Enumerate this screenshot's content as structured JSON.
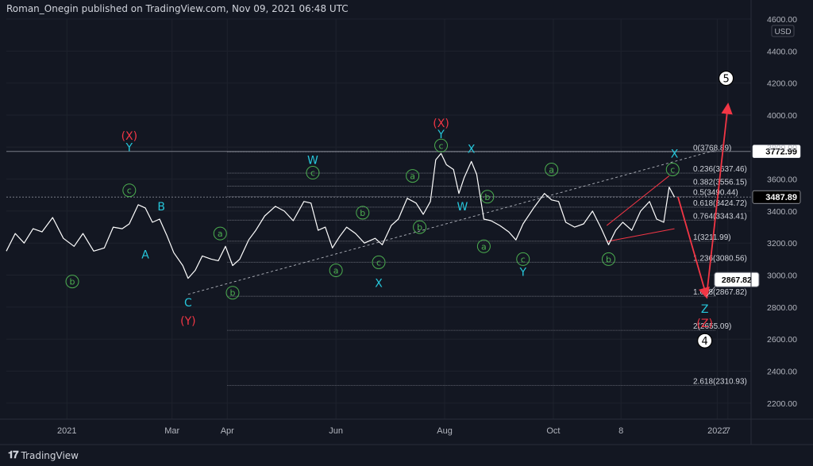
{
  "header": {
    "publisher": "Roman_Onegin published on TradingView.com, Nov 09, 2021 06:48 UTC"
  },
  "footer": {
    "brand": "TradingView",
    "logo_icon": "tradingview-logo-icon"
  },
  "colors": {
    "background": "#131722",
    "grid": "#1e222d",
    "axis_text": "#b2b5be",
    "price": "#ffffff",
    "wave_green": "#4caf50",
    "wave_cyan": "#26c6da",
    "wave_red": "#f23645",
    "fib": "#787b86",
    "arrow": "#f23645"
  },
  "chart_data": {
    "type": "line",
    "symbol_currency": "USD",
    "ylim": [
      2100,
      4600
    ],
    "y_ticks": [
      2200,
      2400,
      2600,
      2800,
      3000,
      3200,
      3400,
      3600,
      3800,
      4000,
      4200,
      4400,
      4600
    ],
    "y_tick_labels": [
      "2200.00",
      "2400.00",
      "2600.00",
      "2800.00",
      "3000.00",
      "3200.00",
      "3400.00",
      "3600.00",
      "3800.00",
      "4000.00",
      "4200.00",
      "4400.00",
      "4600.00"
    ],
    "x_ticks": [
      {
        "label": "2021",
        "date": "2021-01-01"
      },
      {
        "label": "Mar",
        "date": "2021-03-01"
      },
      {
        "label": "Apr",
        "date": "2021-04-01"
      },
      {
        "label": "Jun",
        "date": "2021-06-01"
      },
      {
        "label": "Aug",
        "date": "2021-08-01"
      },
      {
        "label": "Oct",
        "date": "2021-10-01"
      },
      {
        "label": "8",
        "date": "2021-11-08"
      },
      {
        "label": "2022",
        "date": "2022-01-01"
      },
      {
        "label": "7",
        "date": "2022-01-07"
      }
    ],
    "series": [
      {
        "points": [
          [
            "2020-11-28",
            3150
          ],
          [
            "2020-12-03",
            3260
          ],
          [
            "2020-12-08",
            3200
          ],
          [
            "2020-12-13",
            3290
          ],
          [
            "2020-12-18",
            3270
          ],
          [
            "2020-12-24",
            3360
          ],
          [
            "2020-12-30",
            3230
          ],
          [
            "2021-01-05",
            3180
          ],
          [
            "2021-01-10",
            3260
          ],
          [
            "2021-01-16",
            3150
          ],
          [
            "2021-01-22",
            3170
          ],
          [
            "2021-01-27",
            3300
          ],
          [
            "2021-02-01",
            3290
          ],
          [
            "2021-02-05",
            3320
          ],
          [
            "2021-02-10",
            3440
          ],
          [
            "2021-02-14",
            3420
          ],
          [
            "2021-02-18",
            3330
          ],
          [
            "2021-02-22",
            3350
          ],
          [
            "2021-02-26",
            3250
          ],
          [
            "2021-03-02",
            3140
          ],
          [
            "2021-03-07",
            3060
          ],
          [
            "2021-03-10",
            2980
          ],
          [
            "2021-03-14",
            3030
          ],
          [
            "2021-03-18",
            3120
          ],
          [
            "2021-03-23",
            3100
          ],
          [
            "2021-03-27",
            3090
          ],
          [
            "2021-03-31",
            3180
          ],
          [
            "2021-04-04",
            3060
          ],
          [
            "2021-04-08",
            3100
          ],
          [
            "2021-04-13",
            3220
          ],
          [
            "2021-04-17",
            3280
          ],
          [
            "2021-04-22",
            3370
          ],
          [
            "2021-04-28",
            3430
          ],
          [
            "2021-05-03",
            3400
          ],
          [
            "2021-05-08",
            3340
          ],
          [
            "2021-05-14",
            3460
          ],
          [
            "2021-05-18",
            3450
          ],
          [
            "2021-05-22",
            3280
          ],
          [
            "2021-05-26",
            3300
          ],
          [
            "2021-05-30",
            3170
          ],
          [
            "2021-06-03",
            3240
          ],
          [
            "2021-06-07",
            3300
          ],
          [
            "2021-06-12",
            3260
          ],
          [
            "2021-06-17",
            3200
          ],
          [
            "2021-06-23",
            3230
          ],
          [
            "2021-06-27",
            3190
          ],
          [
            "2021-07-02",
            3310
          ],
          [
            "2021-07-06",
            3350
          ],
          [
            "2021-07-11",
            3480
          ],
          [
            "2021-07-16",
            3450
          ],
          [
            "2021-07-20",
            3380
          ],
          [
            "2021-07-24",
            3460
          ],
          [
            "2021-07-27",
            3720
          ],
          [
            "2021-07-30",
            3760
          ],
          [
            "2021-08-02",
            3690
          ],
          [
            "2021-08-06",
            3660
          ],
          [
            "2021-08-09",
            3510
          ],
          [
            "2021-08-12",
            3610
          ],
          [
            "2021-08-16",
            3710
          ],
          [
            "2021-08-19",
            3630
          ],
          [
            "2021-08-23",
            3350
          ],
          [
            "2021-08-27",
            3340
          ],
          [
            "2021-09-01",
            3310
          ],
          [
            "2021-09-06",
            3270
          ],
          [
            "2021-09-10",
            3220
          ],
          [
            "2021-09-14",
            3320
          ],
          [
            "2021-09-20",
            3420
          ],
          [
            "2021-09-26",
            3510
          ],
          [
            "2021-09-30",
            3470
          ],
          [
            "2021-10-04",
            3460
          ],
          [
            "2021-10-08",
            3330
          ],
          [
            "2021-10-13",
            3300
          ],
          [
            "2021-10-18",
            3320
          ],
          [
            "2021-10-23",
            3400
          ],
          [
            "2021-10-28",
            3290
          ],
          [
            "2021-11-01",
            3190
          ],
          [
            "2021-11-05",
            3280
          ],
          [
            "2021-11-09",
            3330
          ],
          [
            "2021-11-14",
            3280
          ],
          [
            "2021-11-19",
            3400
          ],
          [
            "2021-11-24",
            3460
          ],
          [
            "2021-11-28",
            3350
          ],
          [
            "2021-12-02",
            3330
          ],
          [
            "2021-12-05",
            3550
          ],
          [
            "2021-12-08",
            3487.89
          ]
        ]
      }
    ],
    "price_labels": [
      {
        "label": "3772.99",
        "value": 3772.99,
        "style": "white"
      },
      {
        "label": "3487.89",
        "value": 3487.89,
        "style": "dark"
      }
    ],
    "horizontal_lines": [
      {
        "value": 3772.99,
        "color": "#787b86"
      },
      {
        "value": 3487.89,
        "color": "#787b86",
        "dashed": true
      }
    ],
    "fib_levels": [
      {
        "ratio": "0",
        "price": "3768.89",
        "value": 3768.89,
        "label": "0(3768.89)"
      },
      {
        "ratio": "0.236",
        "price": "3637.46",
        "value": 3637.46,
        "label": "0.236(3637.46)"
      },
      {
        "ratio": "0.382",
        "price": "3556.15",
        "value": 3556.15,
        "label": "0.382(3556.15)"
      },
      {
        "ratio": "0.5",
        "price": "3490.44",
        "value": 3490.44,
        "label": "0.5(3490.44)"
      },
      {
        "ratio": "0.618",
        "price": "3424.72",
        "value": 3424.72,
        "label": "0.618(3424.72)"
      },
      {
        "ratio": "0.764",
        "price": "3343.41",
        "value": 3343.41,
        "label": "0.764(3343.41)"
      },
      {
        "ratio": "1",
        "price": "3211.99",
        "value": 3211.99,
        "label": "1(3211.99)"
      },
      {
        "ratio": "1.236",
        "price": "3080.56",
        "value": 3080.56,
        "label": "1.236(3080.56)"
      },
      {
        "ratio": "1.618",
        "price": "2867.82",
        "value": 2867.82,
        "label": "1.618(2867.82)"
      },
      {
        "ratio": "2",
        "price": "2655.09",
        "value": 2655.09,
        "label": "2(2655.09)"
      },
      {
        "ratio": "2.618",
        "price": "2310.93",
        "value": 2310.93,
        "label": "2.618(2310.93)"
      }
    ],
    "fib_range": {
      "from": "2021-04-01",
      "to": "2021-12-31"
    },
    "trendline": {
      "from": [
        "2021-03-10",
        2880
      ],
      "to": [
        "2021-12-31",
        3780
      ]
    },
    "triangle": {
      "upper": [
        [
          "2021-10-31",
          3310
        ],
        [
          "2021-12-05",
          3620
        ]
      ],
      "lower": [
        [
          "2021-10-31",
          3210
        ],
        [
          "2021-12-08",
          3290
        ]
      ]
    },
    "projection": {
      "points": [
        [
          "2021-12-10",
          3487.89
        ],
        [
          "2021-12-26",
          2867.82
        ],
        [
          "2022-01-07",
          4060
        ]
      ],
      "target_label": "2867.82",
      "target_value": 2867.82
    },
    "annotations": [
      {
        "text": "b",
        "kind": "green-circle",
        "date": "2021-01-04",
        "value": 2960
      },
      {
        "text": "(X)",
        "kind": "red",
        "date": "2021-02-05",
        "value": 3870
      },
      {
        "text": "Y",
        "kind": "cyan",
        "date": "2021-02-05",
        "value": 3800
      },
      {
        "text": "c",
        "kind": "green-circle",
        "date": "2021-02-05",
        "value": 3530
      },
      {
        "text": "B",
        "kind": "cyan",
        "date": "2021-02-23",
        "value": 3430
      },
      {
        "text": "A",
        "kind": "cyan",
        "date": "2021-02-14",
        "value": 3130
      },
      {
        "text": "C",
        "kind": "cyan",
        "date": "2021-03-10",
        "value": 2830
      },
      {
        "text": "(Y)",
        "kind": "red",
        "date": "2021-03-10",
        "value": 2715
      },
      {
        "text": "a",
        "kind": "green-circle",
        "date": "2021-03-28",
        "value": 3260
      },
      {
        "text": "b",
        "kind": "green-circle",
        "date": "2021-04-04",
        "value": 2890
      },
      {
        "text": "W",
        "kind": "cyan",
        "date": "2021-05-19",
        "value": 3720
      },
      {
        "text": "c",
        "kind": "green-circle",
        "date": "2021-05-19",
        "value": 3640
      },
      {
        "text": "a",
        "kind": "green-circle",
        "date": "2021-06-01",
        "value": 3030
      },
      {
        "text": "b",
        "kind": "green-circle",
        "date": "2021-06-16",
        "value": 3390
      },
      {
        "text": "c",
        "kind": "green-circle",
        "date": "2021-06-25",
        "value": 3080
      },
      {
        "text": "X",
        "kind": "cyan",
        "date": "2021-06-25",
        "value": 2950
      },
      {
        "text": "a",
        "kind": "green-circle",
        "date": "2021-07-14",
        "value": 3620
      },
      {
        "text": "b",
        "kind": "green-circle",
        "date": "2021-07-18",
        "value": 3300
      },
      {
        "text": "(X)",
        "kind": "red",
        "date": "2021-07-30",
        "value": 3950
      },
      {
        "text": "Y",
        "kind": "cyan",
        "date": "2021-07-30",
        "value": 3880
      },
      {
        "text": "c",
        "kind": "green-circle",
        "date": "2021-07-30",
        "value": 3810
      },
      {
        "text": "X",
        "kind": "cyan",
        "date": "2021-08-16",
        "value": 3790
      },
      {
        "text": "W",
        "kind": "cyan",
        "date": "2021-08-11",
        "value": 3430
      },
      {
        "text": "b",
        "kind": "green-circle",
        "date": "2021-08-25",
        "value": 3490
      },
      {
        "text": "a",
        "kind": "green-circle",
        "date": "2021-08-23",
        "value": 3180
      },
      {
        "text": "c",
        "kind": "green-circle",
        "date": "2021-09-14",
        "value": 3100
      },
      {
        "text": "Y",
        "kind": "cyan",
        "date": "2021-09-14",
        "value": 3020
      },
      {
        "text": "a",
        "kind": "green-circle",
        "date": "2021-09-30",
        "value": 3660
      },
      {
        "text": "b",
        "kind": "green-circle",
        "date": "2021-11-01",
        "value": 3100
      },
      {
        "text": "X",
        "kind": "cyan",
        "date": "2021-12-08",
        "value": 3760
      },
      {
        "text": "c",
        "kind": "green-circle",
        "date": "2021-12-07",
        "value": 3660
      },
      {
        "text": "Z",
        "kind": "cyan",
        "date": "2021-12-25",
        "value": 2790
      },
      {
        "text": "(Z)",
        "kind": "red",
        "date": "2021-12-25",
        "value": 2700
      },
      {
        "text": "4",
        "kind": "black-circle",
        "date": "2021-12-25",
        "value": 2590
      },
      {
        "text": "5",
        "kind": "black-circle",
        "date": "2022-01-06",
        "value": 4230
      }
    ]
  }
}
